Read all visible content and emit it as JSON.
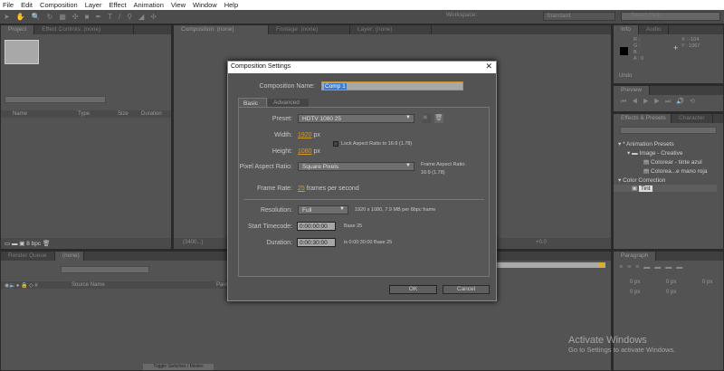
{
  "menu": [
    "File",
    "Edit",
    "Composition",
    "Layer",
    "Effect",
    "Animation",
    "View",
    "Window",
    "Help"
  ],
  "workspace": {
    "label": "Workspace:",
    "value": "Standard",
    "search_placeholder": "Search Help"
  },
  "project_panel": {
    "tabs": [
      "Project",
      "Effect Controls: (none)"
    ],
    "columns": [
      "Name",
      "Type",
      "Size",
      "Duration"
    ],
    "bpc": "8 bpc"
  },
  "comp_panel": {
    "tabs": [
      "Composition: (none)",
      "Footage: (none)",
      "Layer: (none)"
    ],
    "zoom": "(3400...)",
    "exposure": "+0.0"
  },
  "info_panel": {
    "tabs": [
      "Info",
      "Audio"
    ],
    "r": "R :",
    "g": "G :",
    "b": "B :",
    "a": "A : 0",
    "x": "X : -104",
    "y": "Y : 1067",
    "undo": "Undo"
  },
  "preview_panel": {
    "tab": "Preview"
  },
  "effects_panel": {
    "tabs": [
      "Effects & Presets",
      "Character"
    ],
    "tree": [
      "* Animation Presets",
      "Image - Creative",
      "Colorear - tinte azul",
      "Colorea...e mano roja",
      "Color Correction",
      "Tint"
    ]
  },
  "timeline": {
    "tabs": [
      "Render Queue",
      "(none)"
    ],
    "columns": [
      "Source Name",
      "Parent"
    ],
    "toggle": "Toggle Switches / Modes"
  },
  "paragraph_panel": {
    "tab": "Paragraph",
    "values": [
      "0 px",
      "0 px",
      "0 px",
      "0 px",
      "0 px"
    ]
  },
  "dialog": {
    "title": "Composition Settings",
    "comp_name_label": "Composition Name:",
    "comp_name": "Comp 1",
    "tabs": [
      "Basic",
      "Advanced"
    ],
    "preset_label": "Preset:",
    "preset": "HDTV 1080 25",
    "width_label": "Width:",
    "width": "1920",
    "height_label": "Height:",
    "height": "1080",
    "px": "px",
    "lock_label": "Lock Aspect Ratio to 16:9 (1.78)",
    "lock_checked": false,
    "par_label": "Pixel Aspect Ratio:",
    "par": "Square Pixels",
    "far_label": "Frame Aspect Ratio:",
    "far": "16:9 (1.78)",
    "fr_label": "Frame Rate:",
    "fr": "25",
    "fr_unit": "frames per second",
    "res_label": "Resolution:",
    "res": "Full",
    "res_info": "1920 x 1080, 7.9 MB per 8bpc frame",
    "start_label": "Start Timecode:",
    "start": "0:00:00:00",
    "start_base": "Base 25",
    "dur_label": "Duration:",
    "dur": "0:00:30:00",
    "dur_info": "is 0:00:30:00  Base 25",
    "ok": "OK",
    "cancel": "Cancel"
  },
  "watermark": {
    "title": "Activate Windows",
    "sub": "Go to Settings to activate Windows."
  },
  "colors": {
    "accent": "#d79a2a",
    "panel": "#535353",
    "highlight": "#4a7ab8"
  }
}
